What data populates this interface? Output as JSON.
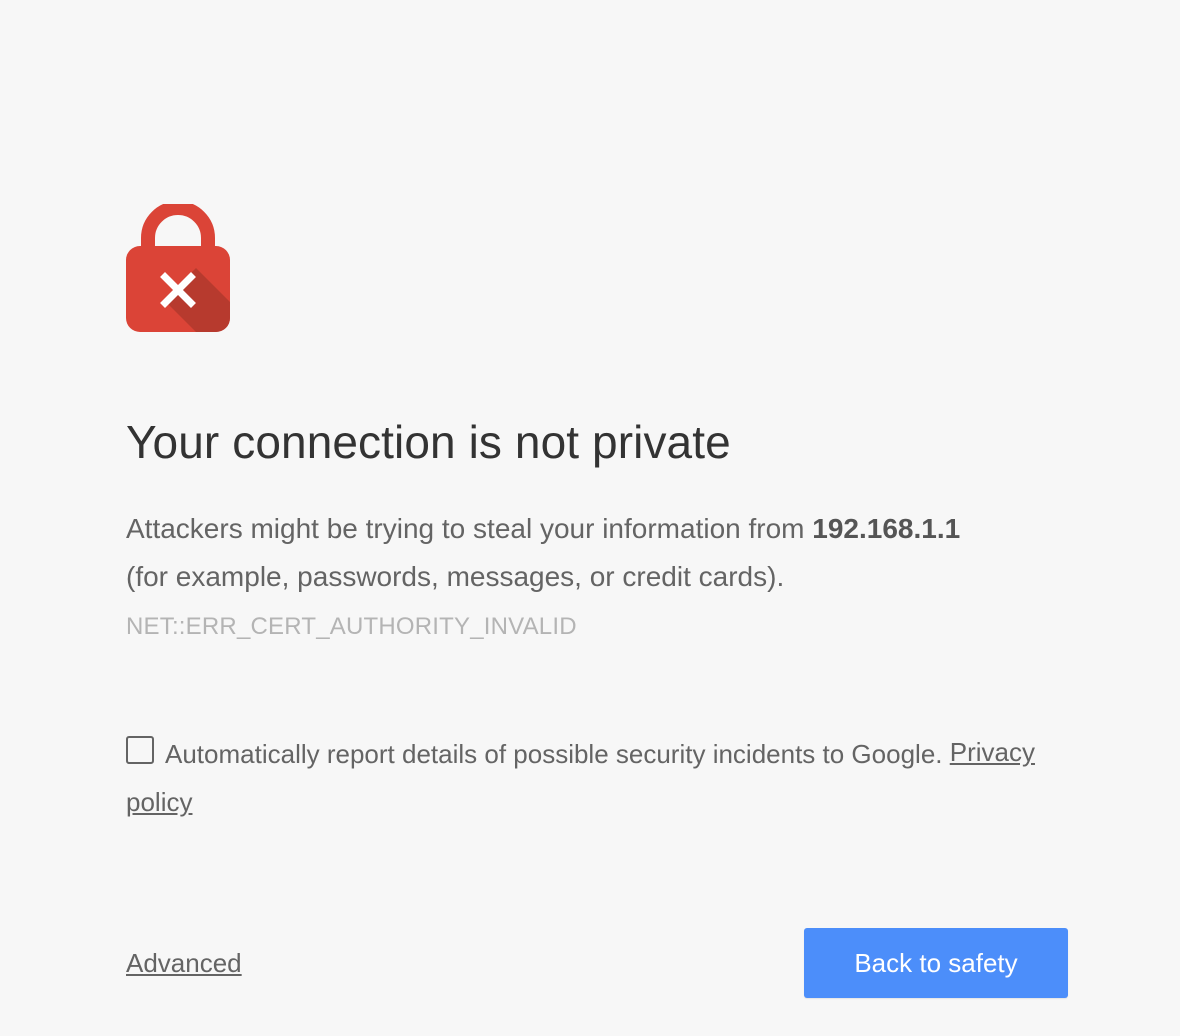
{
  "interstitial": {
    "icon": "lock-with-x-icon",
    "icon_color": "#db4437",
    "headline": "Your connection is not private",
    "explanation_before_host": "Attackers might be trying to steal your information from ",
    "host": "192.168.1.1",
    "explanation_after_host": " (for example, passwords, messages, or credit cards).",
    "error_code": "NET::ERR_CERT_AUTHORITY_INVALID",
    "report": {
      "checked": false,
      "text": "Automatically report details of possible security incidents to Google. ",
      "privacy_link": "Privacy policy"
    },
    "advanced_link": "Advanced",
    "primary_button": "Back to safety",
    "primary_button_color": "#4c8efa"
  }
}
